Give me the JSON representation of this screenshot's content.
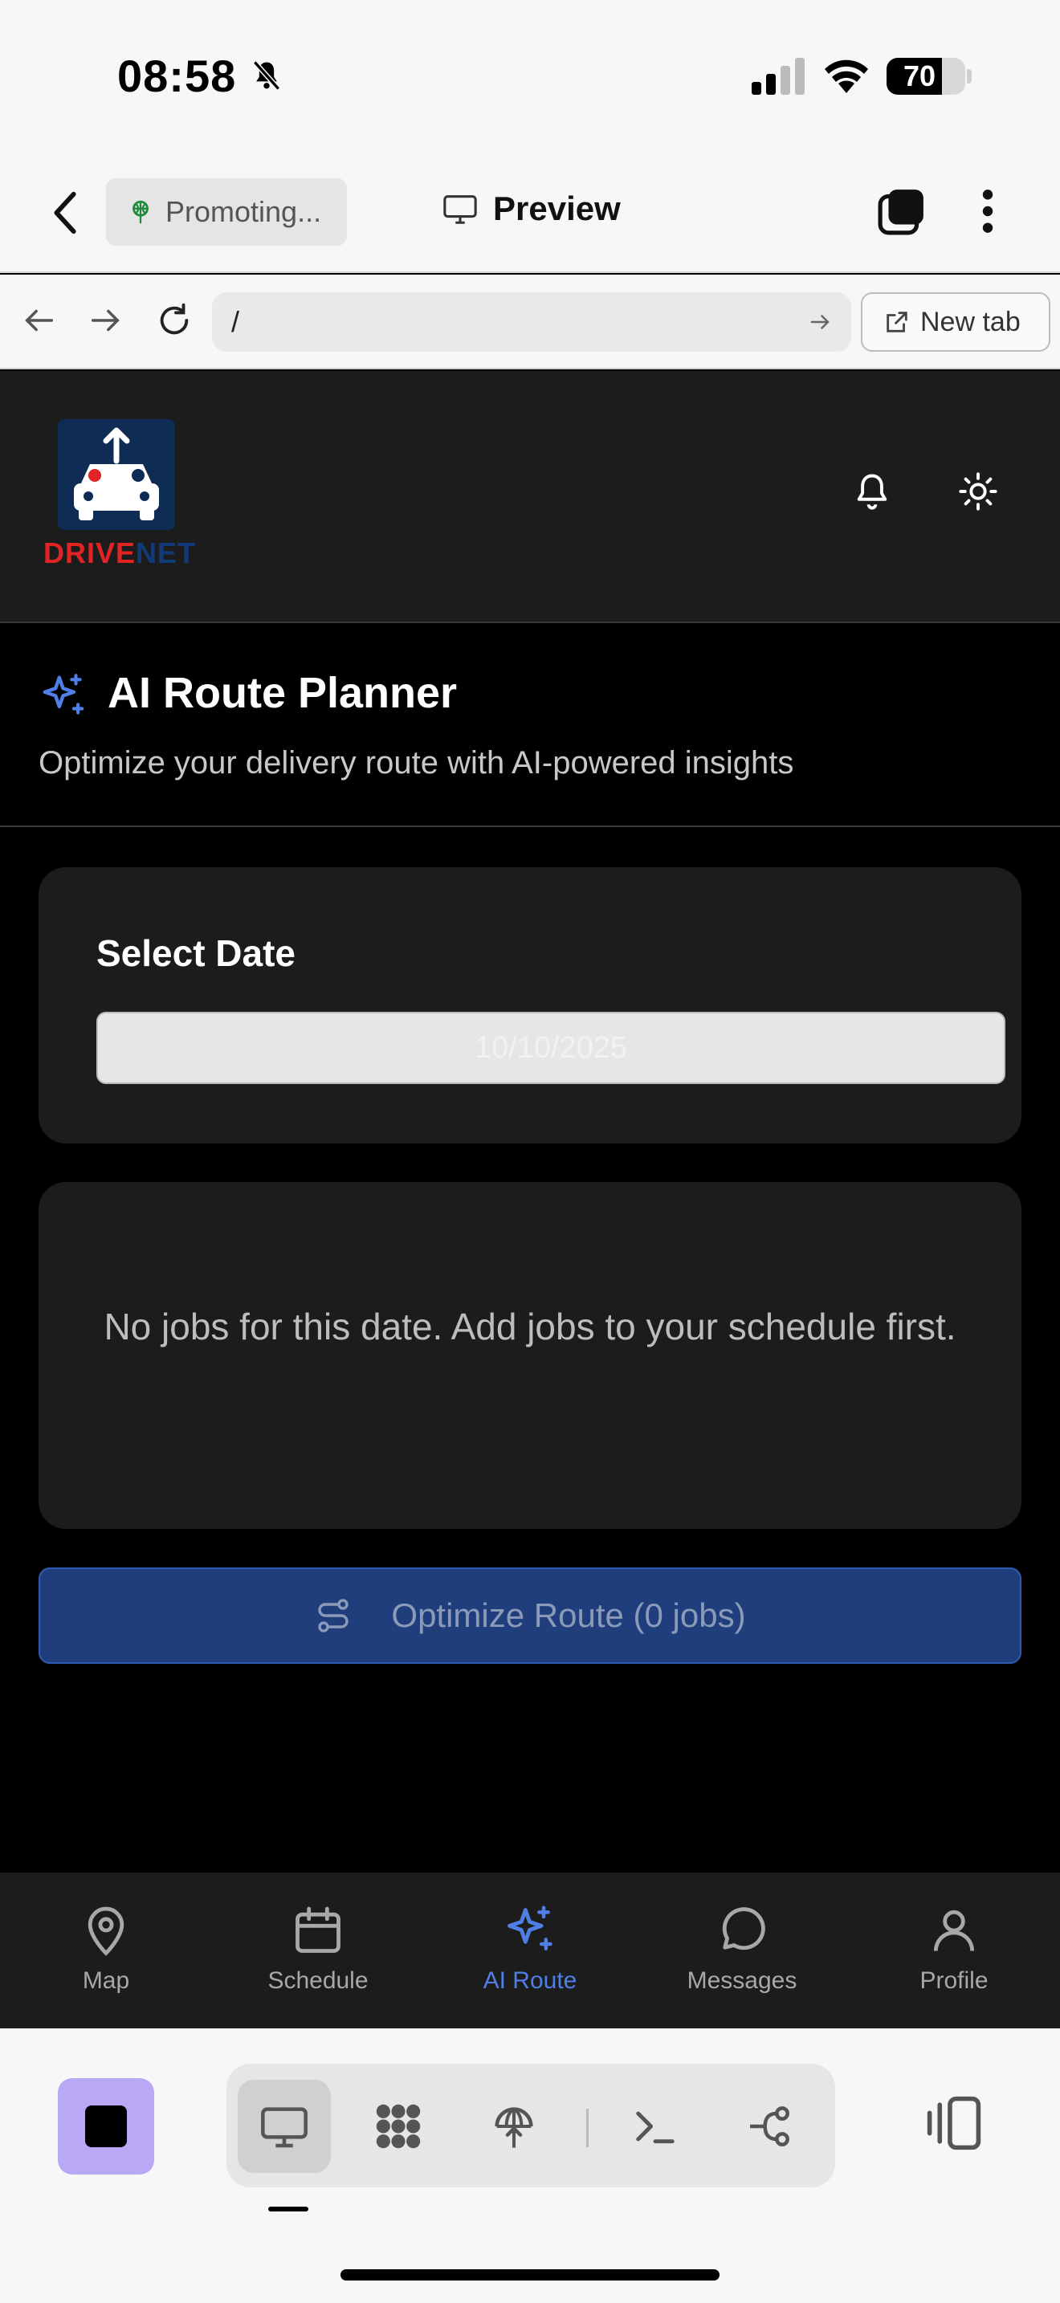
{
  "status_bar": {
    "time": "08:58",
    "battery": "70",
    "battery_level": 0.7
  },
  "app_header": {
    "project_name": "Promoting...",
    "preview_label": "Preview"
  },
  "browser": {
    "url": "/",
    "new_tab_label": "New tab"
  },
  "site": {
    "logo_text_red": "DRIVE",
    "logo_text_blue": "NET"
  },
  "page": {
    "title": "AI Route Planner",
    "subtitle": "Optimize your delivery route with AI-powered insights"
  },
  "date_card": {
    "label": "Select Date",
    "value": "10/10/2025"
  },
  "empty_state": {
    "message": "No jobs for this date. Add jobs to your schedule first."
  },
  "optimize_button": {
    "label": "Optimize Route (0 jobs)"
  },
  "bottom_nav": {
    "items": [
      {
        "label": "Map",
        "icon": "map-pin-icon"
      },
      {
        "label": "Schedule",
        "icon": "calendar-icon"
      },
      {
        "label": "AI Route",
        "icon": "sparkles-icon",
        "active": true
      },
      {
        "label": "Messages",
        "icon": "chat-bubble-icon"
      },
      {
        "label": "Profile",
        "icon": "user-icon"
      }
    ]
  },
  "colors": {
    "accent": "#4f7fe6",
    "button_bg": "#203e7c",
    "card_bg": "#1c1c1c",
    "stop_button": "#b9a8f5"
  }
}
